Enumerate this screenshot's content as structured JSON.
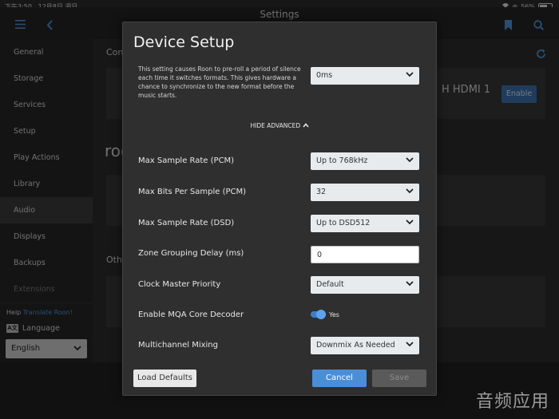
{
  "status_bar": {
    "time": "下午3:50",
    "date": "12月8日 週日",
    "battery": "56%"
  },
  "header": {
    "title": "Settings"
  },
  "sidebar": {
    "items": [
      {
        "label": "General"
      },
      {
        "label": "Storage"
      },
      {
        "label": "Services"
      },
      {
        "label": "Setup"
      },
      {
        "label": "Play Actions"
      },
      {
        "label": "Library"
      },
      {
        "label": "Audio"
      },
      {
        "label": "Displays"
      },
      {
        "label": "Backups"
      },
      {
        "label": "Extensions"
      }
    ],
    "active": "Audio",
    "help_prefix": "Help",
    "help_link": "Translate Roon!",
    "language_label": "Language",
    "language_value": "English"
  },
  "background": {
    "section1_partial": "Con",
    "device_name_partial": "H HDMI 1",
    "enable_label": "Enable",
    "roon_partial": "roo",
    "section2_partial": "Oth"
  },
  "modal": {
    "title": "Device Setup",
    "preroll_description": "This setting causes Roon to pre-roll a period of silence each time it switches formats. This gives hardware a chance to synchronize to the new format before the music starts.",
    "preroll_value": "0ms",
    "advanced_toggle": "HIDE ADVANCED",
    "rows": {
      "max_pcm_label": "Max Sample Rate (PCM)",
      "max_pcm_value": "Up to 768kHz",
      "max_bits_label": "Max Bits Per Sample (PCM)",
      "max_bits_value": "32",
      "max_dsd_label": "Max Sample Rate (DSD)",
      "max_dsd_value": "Up to DSD512",
      "zone_delay_label": "Zone Grouping Delay (ms)",
      "zone_delay_value": "0",
      "clock_label": "Clock Master Priority",
      "clock_value": "Default",
      "mqa_label": "Enable MQA Core Decoder",
      "mqa_value": "Yes",
      "multichannel_label": "Multichannel Mixing",
      "multichannel_value": "Downmix As Needed"
    },
    "buttons": {
      "defaults": "Load Defaults",
      "cancel": "Cancel",
      "save": "Save"
    }
  },
  "watermark": "音频应用",
  "colors": {
    "accent": "#4a8ed8",
    "modal_bg": "#2f2f2f",
    "sidebar_active": "#3a3a3a"
  },
  "icons": [
    "hamburger-icon",
    "back-arrow-icon",
    "bookmark-icon",
    "search-icon",
    "refresh-icon",
    "wifi-icon",
    "chevron-down-icon",
    "chevron-up-icon",
    "language-icon"
  ]
}
